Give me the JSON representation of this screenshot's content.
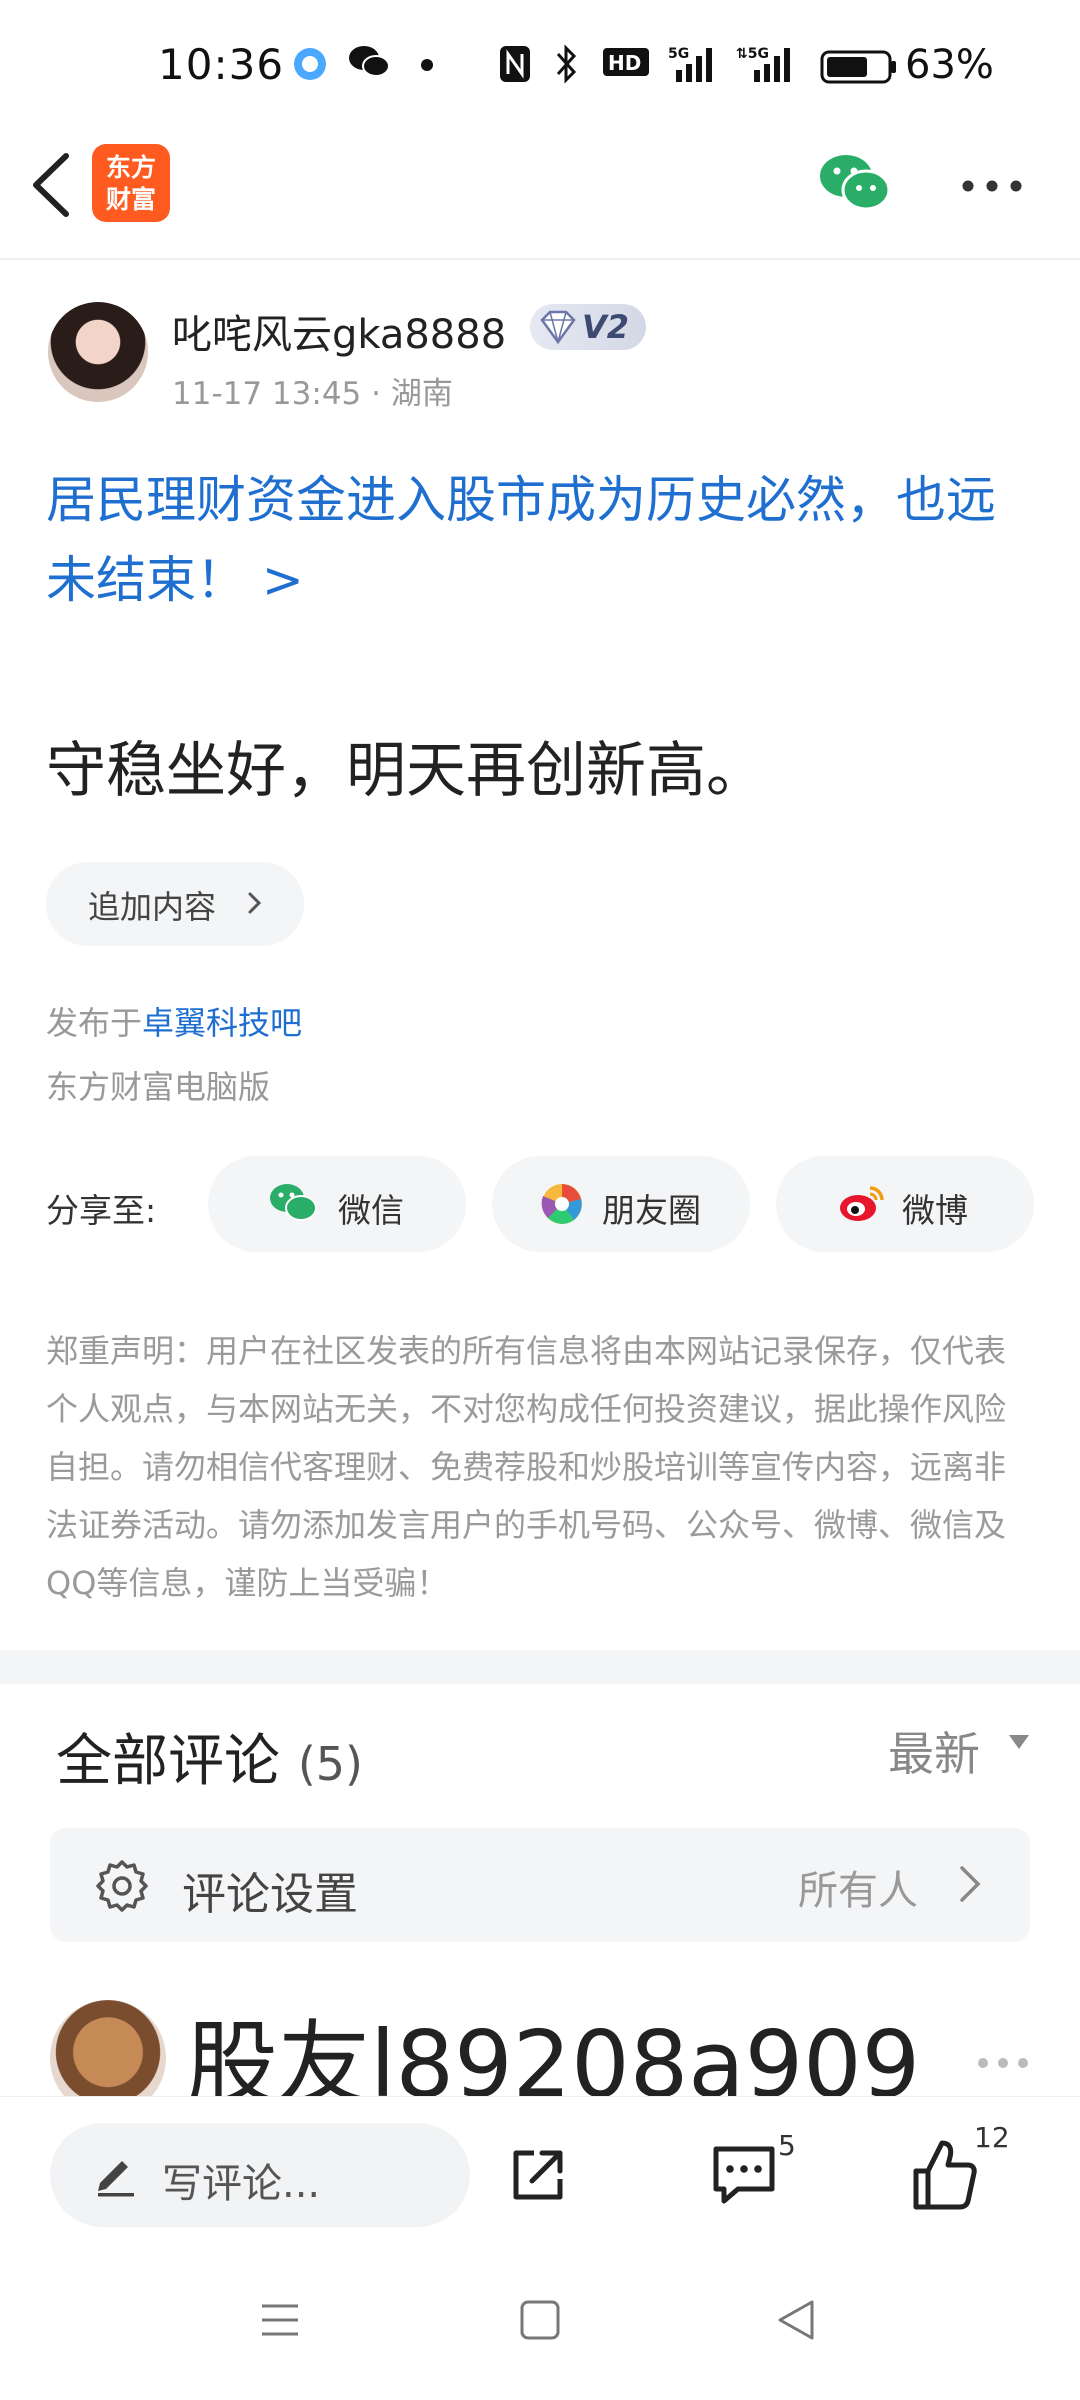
{
  "status_bar": {
    "time": "10:36",
    "battery": "63%",
    "icons": [
      "browser-icon",
      "wechat-icon",
      "dot-icon",
      "nfc-icon",
      "bluetooth-icon",
      "hd-icon",
      "signal-5g-icon",
      "signal-5g-icon",
      "battery-icon"
    ]
  },
  "nav": {
    "logo_line1": "东方",
    "logo_line2": "财富"
  },
  "post": {
    "author": "叱咤风云gka8888",
    "level": "V2",
    "date": "11-17 13:45",
    "location": "· 湖南",
    "title": "居民理财资金进入股市成为历史必然，也远未结束！ >",
    "body": "守稳坐好，明天再创新高。",
    "append_label": "追加内容",
    "published_prefix": "发布于",
    "published_bar": "卓翼科技吧",
    "source": "东方财富电脑版"
  },
  "share": {
    "label": "分享至:",
    "wechat": "微信",
    "moments": "朋友圈",
    "weibo": "微博"
  },
  "disclaimer": "郑重声明：用户在社区发表的所有信息将由本网站记录保存，仅代表个人观点，与本网站无关，不对您构成任何投资建议，据此操作风险自担。请勿相信代客理财、免费荐股和炒股培训等宣传内容，远离非法证券活动。请勿添加发言用户的手机号码、公众号、微博、微信及QQ等信息，谨防上当受骗！",
  "comments": {
    "title": "全部评论",
    "count": "(5)",
    "sort": "最新",
    "settings_label": "评论设置",
    "settings_value": "所有人",
    "first_commenter": "股友l89208a909"
  },
  "actions": {
    "write_comment": "写评论...",
    "comment_count": "5",
    "like_count": "12"
  },
  "colors": {
    "link_blue": "#1f6fd1",
    "brand_orange": "#ff5a1f",
    "wechat_green": "#2aae67",
    "weibo_red": "#e6162d"
  }
}
